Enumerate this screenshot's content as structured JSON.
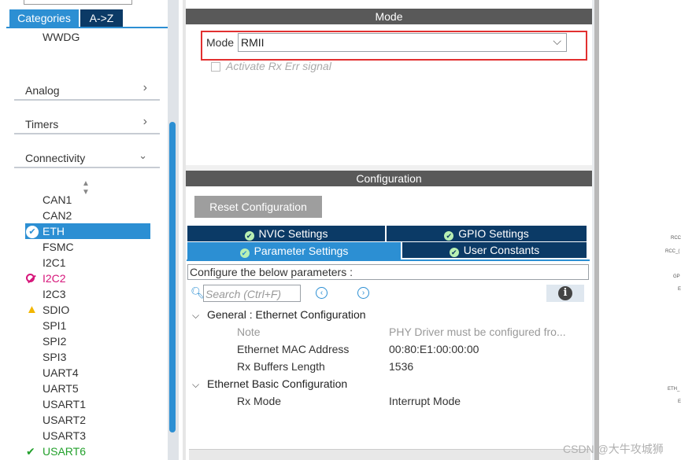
{
  "left": {
    "tabs": [
      "Categories",
      "A->Z"
    ],
    "top_item": "WWDG",
    "groups": [
      {
        "label": "Analog",
        "chevron": "chevron-right-icon"
      },
      {
        "label": "Timers",
        "chevron": "chevron-right-icon"
      },
      {
        "label": "Connectivity",
        "chevron": "chevron-down-icon"
      }
    ],
    "peripherals": [
      {
        "label": "CAN1",
        "status": ""
      },
      {
        "label": "CAN2",
        "status": ""
      },
      {
        "label": "ETH",
        "status": "ok",
        "selected": true
      },
      {
        "label": "FSMC",
        "status": ""
      },
      {
        "label": "I2C1",
        "status": ""
      },
      {
        "label": "I2C2",
        "status": "disabled"
      },
      {
        "label": "I2C3",
        "status": ""
      },
      {
        "label": "SDIO",
        "status": "warning"
      },
      {
        "label": "SPI1",
        "status": ""
      },
      {
        "label": "SPI2",
        "status": ""
      },
      {
        "label": "SPI3",
        "status": ""
      },
      {
        "label": "UART4",
        "status": ""
      },
      {
        "label": "UART5",
        "status": ""
      },
      {
        "label": "USART1",
        "status": ""
      },
      {
        "label": "USART2",
        "status": ""
      },
      {
        "label": "USART3",
        "status": ""
      },
      {
        "label": "USART6",
        "status": "enabled"
      }
    ],
    "colors": {
      "selected": "#2c8fd3",
      "disabled": "#d6157a",
      "warning": "#f2b600",
      "enabled": "#22a02b"
    }
  },
  "mode": {
    "section_title": "Mode",
    "mode_label": "Mode",
    "mode_value": "RMII",
    "rx_err_label": "Activate Rx Err signal",
    "rx_err_checked": false
  },
  "config": {
    "section_title": "Configuration",
    "reset_label": "Reset Configuration",
    "tabs": [
      "NVIC Settings",
      "GPIO Settings",
      "Parameter Settings",
      "User Constants"
    ],
    "active_tab": "Parameter Settings",
    "instruction": "Configure the below parameters :",
    "search_placeholder": "Search (Ctrl+F)",
    "groups": [
      {
        "title": "General : Ethernet Configuration",
        "rows": [
          {
            "name": "Note",
            "value": "PHY Driver must be configured fro...",
            "muted": true
          },
          {
            "name": "Ethernet MAC Address",
            "value": "00:80:E1:00:00:00"
          },
          {
            "name": "Rx Buffers Length",
            "value": "1536"
          }
        ]
      },
      {
        "title": "Ethernet Basic Configuration",
        "rows": [
          {
            "name": "Rx Mode",
            "value": "Interrupt Mode"
          }
        ]
      }
    ]
  },
  "right": {
    "pins": [
      "RCC",
      "RCC_(",
      "GP",
      "E",
      "ETH_",
      "E"
    ]
  },
  "watermark": "CSDN @大牛攻城狮"
}
